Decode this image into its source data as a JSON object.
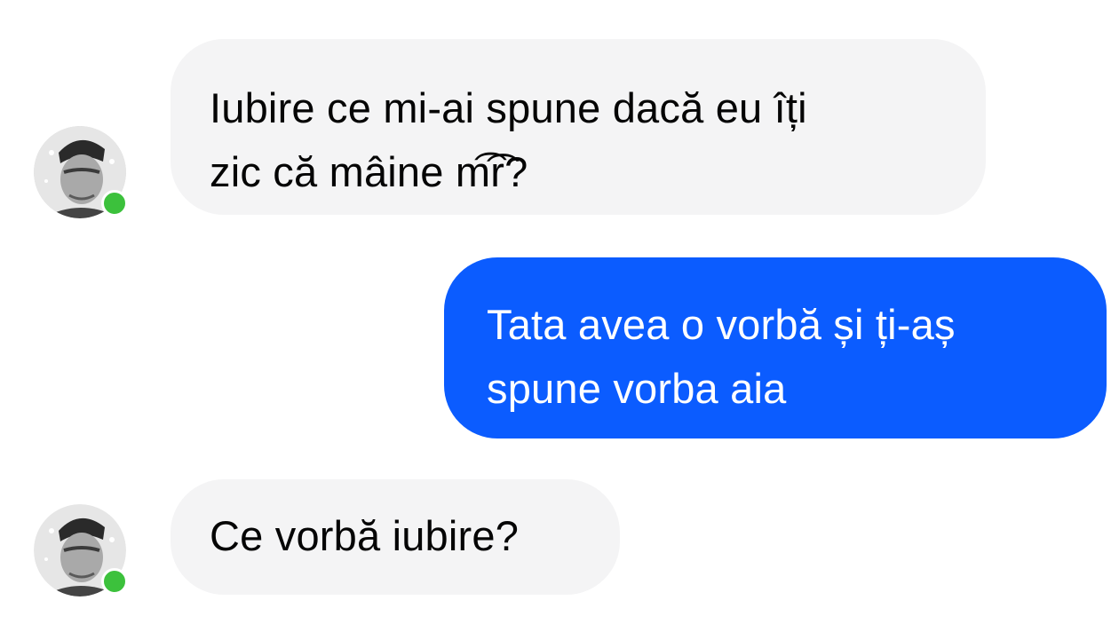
{
  "colors": {
    "incoming_bubble": "#f4f4f5",
    "incoming_text": "#050505",
    "outgoing_bubble": "#0b5cff",
    "outgoing_text": "#ffffff",
    "online_dot": "#3cc13c"
  },
  "messages": [
    {
      "direction": "incoming",
      "lines": [
        "Iubire ce mi-ai spune dacă eu îți",
        "zic că  mâine m͡͡r?"
      ],
      "has_avatar": true,
      "avatar_icon": "user-photo-icon",
      "online": true
    },
    {
      "direction": "outgoing",
      "lines": [
        "Tata avea o vorbă și ți-aș",
        "spune vorba aia"
      ]
    },
    {
      "direction": "incoming",
      "lines": [
        "Ce vorbă iubire?"
      ],
      "has_avatar": true,
      "avatar_icon": "user-photo-icon",
      "online": true
    }
  ]
}
